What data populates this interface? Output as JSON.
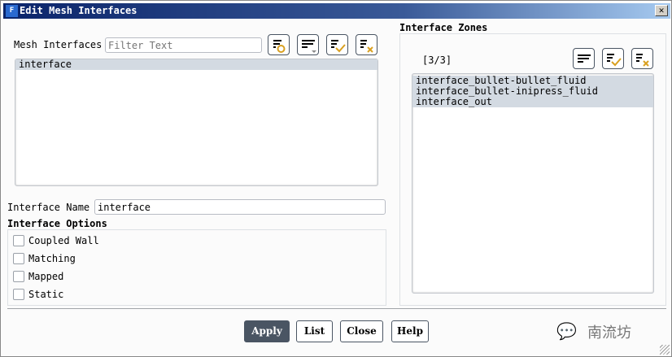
{
  "window": {
    "title": "Edit Mesh Interfaces",
    "icon_letter": "F",
    "close": "✕"
  },
  "mesh_interfaces": {
    "label": "Mesh Interfaces",
    "filter_placeholder": "Filter Text",
    "items": [
      "interface"
    ]
  },
  "interface_name": {
    "label": "Interface Name",
    "value": "interface"
  },
  "interface_options": {
    "title": "Interface Options",
    "options": [
      {
        "label": "Coupled Wall",
        "checked": false
      },
      {
        "label": "Matching",
        "checked": false
      },
      {
        "label": "Mapped",
        "checked": false
      },
      {
        "label": "Static",
        "checked": false
      }
    ]
  },
  "interface_zones": {
    "title": "Interface Zones",
    "count": "[3/3]",
    "items": [
      "interface_bullet-bullet_fluid",
      "interface_bullet-inipress_fluid",
      "interface_out"
    ]
  },
  "buttons": {
    "apply": "Apply",
    "list": "List",
    "close": "Close",
    "help": "Help"
  },
  "watermark": "南流坊",
  "colors": {
    "accent": "#4a5563",
    "selected": "#d3dae2",
    "icon_gold": "#d9a020"
  }
}
